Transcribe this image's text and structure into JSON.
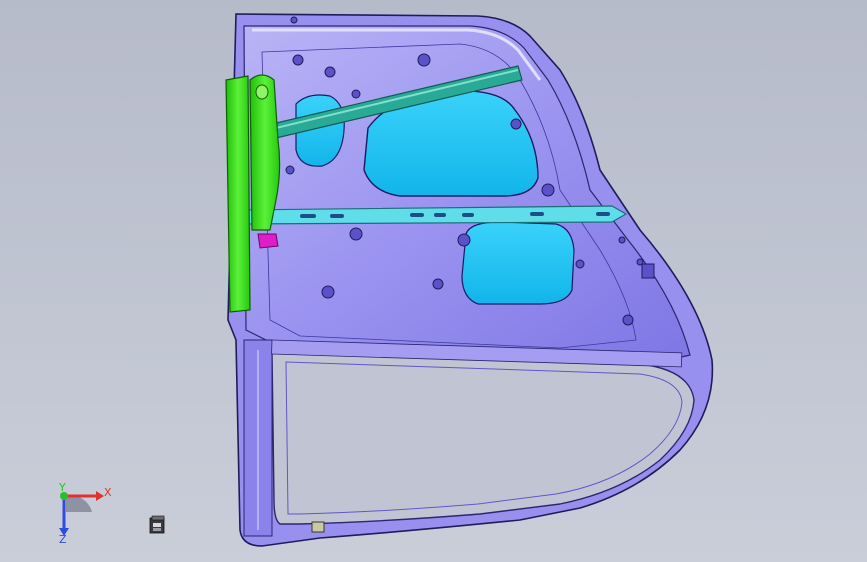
{
  "viewport": {
    "background_top": "#b7bccb",
    "background_bottom": "#c7ccd7",
    "colors": {
      "door_panel": "#8d86ee",
      "door_panel_light": "#c6c2f6",
      "door_outline": "#2a2670",
      "window_cutout": "#21c6f5",
      "guide_rail": "#1f9c8c",
      "regulator_bar": "#4fd8e6",
      "hinge_reinforcement": "#39e014",
      "clip_highlight": "#e01ec9"
    }
  },
  "triad": {
    "x_label": "X",
    "y_label": "Y",
    "z_label": "Z",
    "x_color": "#e23030",
    "y_color": "#2bbd2b",
    "z_color": "#2f4be0"
  },
  "icons": {
    "view_cube": "view-cube-icon"
  }
}
